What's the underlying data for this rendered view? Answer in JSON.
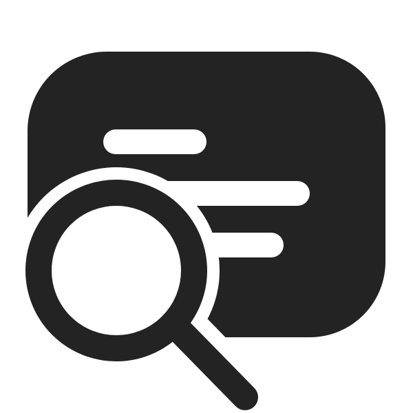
{
  "icon": {
    "name": "text-search-icon",
    "colors": {
      "glyph": "#232323",
      "background": "#ffffff"
    }
  }
}
